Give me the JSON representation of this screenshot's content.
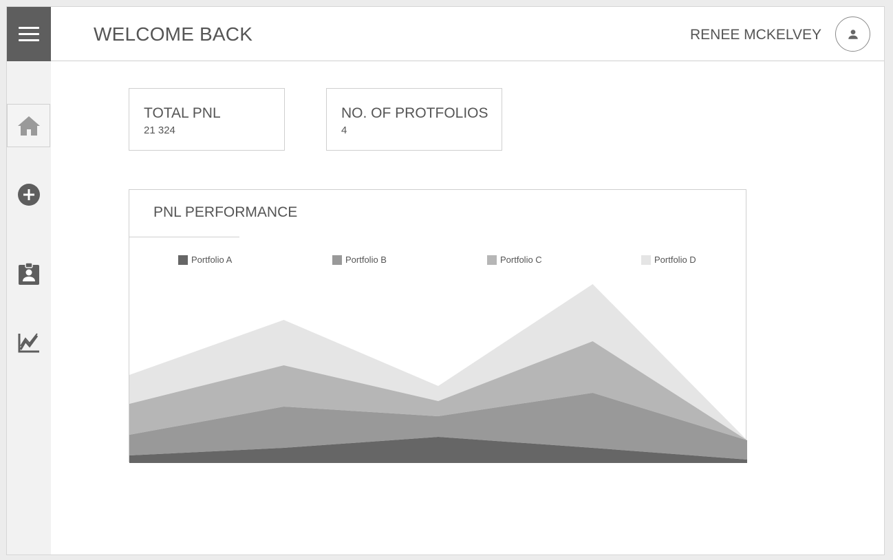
{
  "header": {
    "title": "WELCOME BACK",
    "user_name": "RENEE MCKELVEY"
  },
  "icons": {
    "menu": "hamburger-menu-icon",
    "avatar": "user-icon",
    "sidebar": [
      "home-icon",
      "add-circle-icon",
      "clipboard-user-icon",
      "chart-line-icon"
    ]
  },
  "cards": [
    {
      "title": "TOTAL PNL",
      "value": "21 324"
    },
    {
      "title": "NO. OF PROTFOLIOS",
      "value": "4"
    }
  ],
  "chart": {
    "title": "PNL PERFORMANCE"
  },
  "chart_data": {
    "type": "area",
    "stacked": true,
    "title": "PNL PERFORMANCE",
    "x": [
      "1",
      "2",
      "3",
      "4",
      "5"
    ],
    "series": [
      {
        "name": "Portfolio A",
        "color": "#666666",
        "values": [
          11,
          22,
          38,
          22,
          5
        ]
      },
      {
        "name": "Portfolio B",
        "color": "#999999",
        "values": [
          30,
          60,
          30,
          80,
          28
        ]
      },
      {
        "name": "Portfolio C",
        "color": "#b6b6b6",
        "values": [
          45,
          60,
          22,
          75,
          0
        ]
      },
      {
        "name": "Portfolio D",
        "color": "#e5e5e5",
        "values": [
          42,
          66,
          22,
          83,
          0
        ]
      }
    ],
    "ylim": [
      0,
      265
    ],
    "grid": false,
    "legend_position": "top"
  }
}
